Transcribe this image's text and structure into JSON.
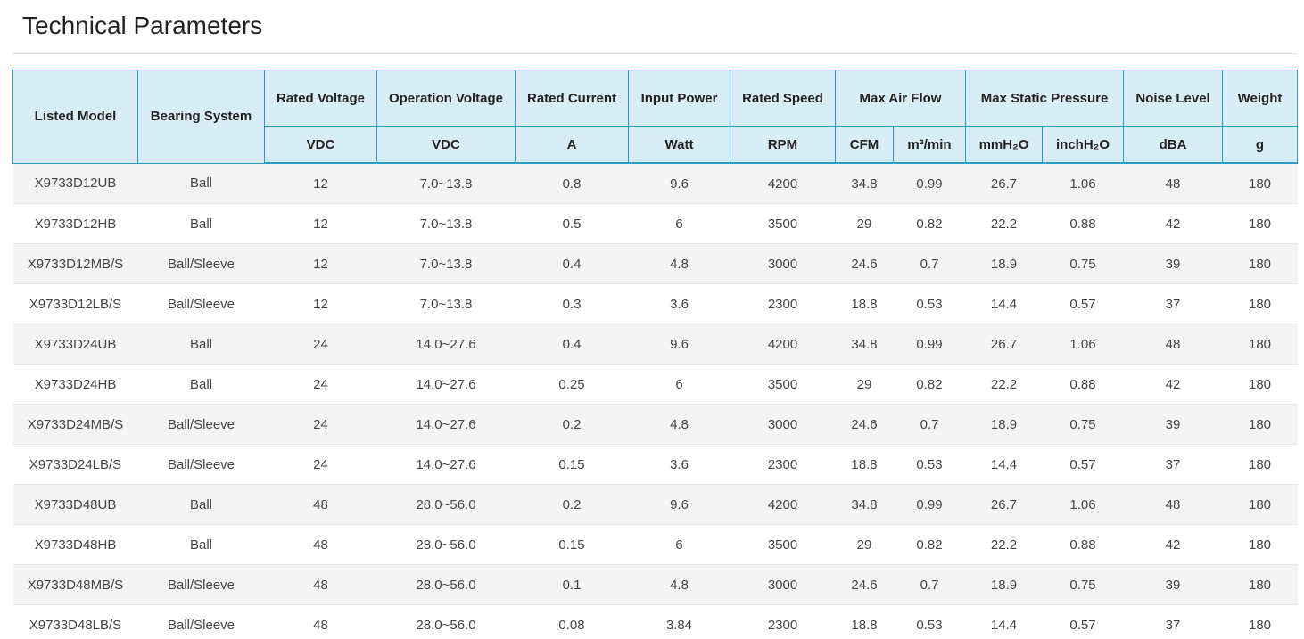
{
  "page": {
    "title": "Technical Parameters"
  },
  "table": {
    "header_top": {
      "listed_model": "Listed Model",
      "bearing_system": "Bearing System",
      "rated_voltage": "Rated Voltage",
      "operation_voltage": "Operation Voltage",
      "rated_current": "Rated Current",
      "input_power": "Input Power",
      "rated_speed": "Rated Speed",
      "max_air_flow": "Max Air Flow",
      "max_static_pressure": "Max Static Pressure",
      "noise_level": "Noise Level",
      "weight": "Weight"
    },
    "header_units": {
      "rated_voltage": "VDC",
      "operation_voltage": "VDC",
      "rated_current": "A",
      "input_power": "Watt",
      "rated_speed": "RPM",
      "air_flow_cfm": "CFM",
      "air_flow_m3": "m³/min",
      "pressure_mmh2o": "mmH₂O",
      "pressure_inchh2o": "inchH₂O",
      "noise_level": "dBA",
      "weight": "g"
    },
    "rows": [
      [
        "X9733D12UB",
        "Ball",
        "12",
        "7.0~13.8",
        "0.8",
        "9.6",
        "4200",
        "34.8",
        "0.99",
        "26.7",
        "1.06",
        "48",
        "180"
      ],
      [
        "X9733D12HB",
        "Ball",
        "12",
        "7.0~13.8",
        "0.5",
        "6",
        "3500",
        "29",
        "0.82",
        "22.2",
        "0.88",
        "42",
        "180"
      ],
      [
        "X9733D12MB/S",
        "Ball/Sleeve",
        "12",
        "7.0~13.8",
        "0.4",
        "4.8",
        "3000",
        "24.6",
        "0.7",
        "18.9",
        "0.75",
        "39",
        "180"
      ],
      [
        "X9733D12LB/S",
        "Ball/Sleeve",
        "12",
        "7.0~13.8",
        "0.3",
        "3.6",
        "2300",
        "18.8",
        "0.53",
        "14.4",
        "0.57",
        "37",
        "180"
      ],
      [
        "X9733D24UB",
        "Ball",
        "24",
        "14.0~27.6",
        "0.4",
        "9.6",
        "4200",
        "34.8",
        "0.99",
        "26.7",
        "1.06",
        "48",
        "180"
      ],
      [
        "X9733D24HB",
        "Ball",
        "24",
        "14.0~27.6",
        "0.25",
        "6",
        "3500",
        "29",
        "0.82",
        "22.2",
        "0.88",
        "42",
        "180"
      ],
      [
        "X9733D24MB/S",
        "Ball/Sleeve",
        "24",
        "14.0~27.6",
        "0.2",
        "4.8",
        "3000",
        "24.6",
        "0.7",
        "18.9",
        "0.75",
        "39",
        "180"
      ],
      [
        "X9733D24LB/S",
        "Ball/Sleeve",
        "24",
        "14.0~27.6",
        "0.15",
        "3.6",
        "2300",
        "18.8",
        "0.53",
        "14.4",
        "0.57",
        "37",
        "180"
      ],
      [
        "X9733D48UB",
        "Ball",
        "48",
        "28.0~56.0",
        "0.2",
        "9.6",
        "4200",
        "34.8",
        "0.99",
        "26.7",
        "1.06",
        "48",
        "180"
      ],
      [
        "X9733D48HB",
        "Ball",
        "48",
        "28.0~56.0",
        "0.15",
        "6",
        "3500",
        "29",
        "0.82",
        "22.2",
        "0.88",
        "42",
        "180"
      ],
      [
        "X9733D48MB/S",
        "Ball/Sleeve",
        "48",
        "28.0~56.0",
        "0.1",
        "4.8",
        "3000",
        "24.6",
        "0.7",
        "18.9",
        "0.75",
        "39",
        "180"
      ],
      [
        "X9733D48LB/S",
        "Ball/Sleeve",
        "48",
        "28.0~56.0",
        "0.08",
        "3.84",
        "2300",
        "18.8",
        "0.53",
        "14.4",
        "0.57",
        "37",
        "180"
      ]
    ]
  },
  "colors": {
    "header_bg": "#d9edf7",
    "header_border": "#2a9dc0",
    "stripe_row": "#f4f4f4"
  }
}
